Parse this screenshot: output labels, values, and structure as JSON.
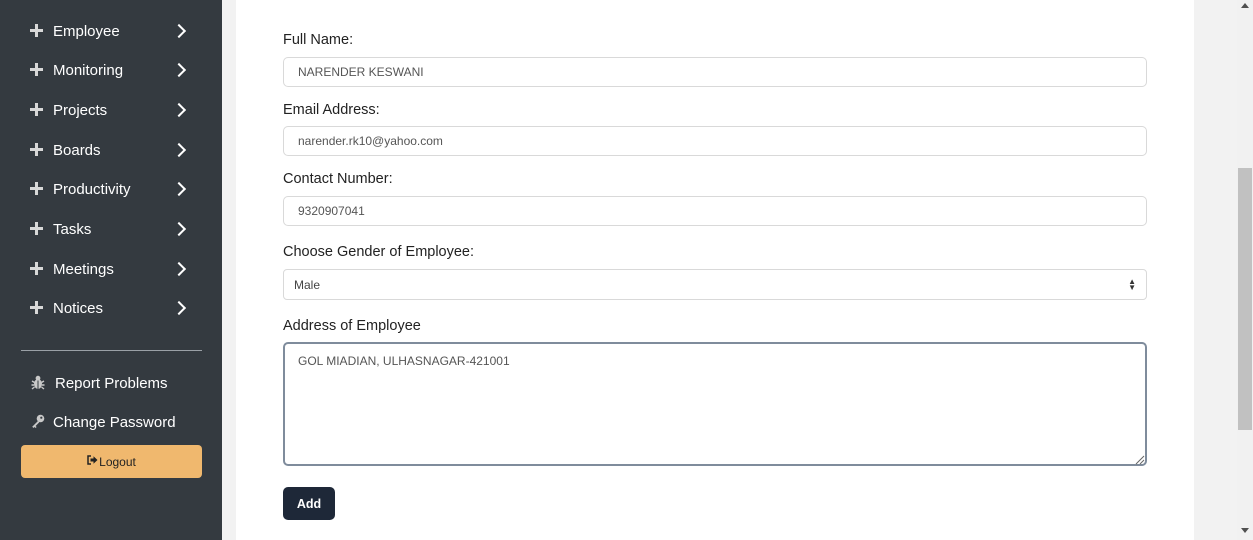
{
  "sidebar": {
    "nav_items": [
      {
        "label": "Employee",
        "icon": "plus-icon",
        "chevron": "chevron-right-icon"
      },
      {
        "label": "Monitoring",
        "icon": "plus-icon",
        "chevron": "chevron-right-icon"
      },
      {
        "label": "Projects",
        "icon": "plus-icon",
        "chevron": "chevron-right-icon"
      },
      {
        "label": "Boards",
        "icon": "plus-icon",
        "chevron": "chevron-right-icon"
      },
      {
        "label": "Productivity",
        "icon": "plus-icon",
        "chevron": "chevron-right-icon"
      },
      {
        "label": "Tasks",
        "icon": "plus-icon",
        "chevron": "chevron-right-icon"
      },
      {
        "label": "Meetings",
        "icon": "plus-icon",
        "chevron": "chevron-right-icon"
      },
      {
        "label": "Notices",
        "icon": "plus-icon",
        "chevron": "chevron-right-icon"
      }
    ],
    "report_problems": {
      "label": "Report Problems",
      "icon": "bug-icon"
    },
    "change_password": {
      "label": "Change Password",
      "icon": "key-icon"
    },
    "logout": {
      "label": "Logout",
      "icon": "sign-out-icon"
    }
  },
  "form": {
    "full_name": {
      "label": "Full Name:",
      "value": "NARENDER KESWANI"
    },
    "email": {
      "label": "Email Address:",
      "value": "narender.rk10@yahoo.com"
    },
    "contact": {
      "label": "Contact Number:",
      "value": "9320907041"
    },
    "gender": {
      "label": "Choose Gender of Employee:",
      "value": "Male"
    },
    "address": {
      "label": "Address of Employee",
      "value": "GOL MIADIAN, ULHASNAGAR-421001"
    },
    "submit_label": "Add"
  },
  "colors": {
    "sidebar_bg": "#343a40",
    "logout_bg": "#f0b86e",
    "add_button_bg": "#1e2838"
  }
}
